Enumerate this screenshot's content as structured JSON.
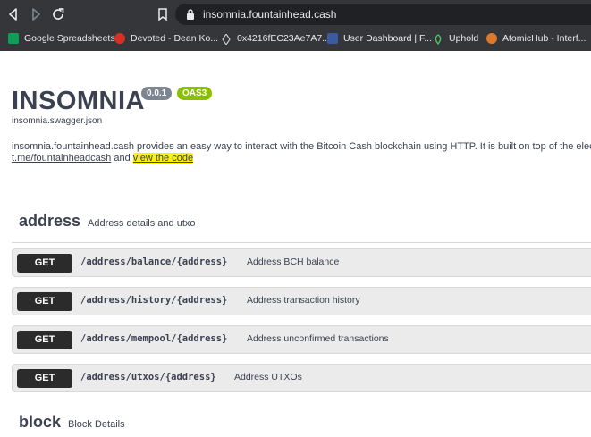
{
  "browser": {
    "url": "insomnia.fountainhead.cash",
    "bookmarks": [
      {
        "label": "Google Spreadsheets",
        "color": "#0f9d58"
      },
      {
        "label": "Devoted - Dean Ko...",
        "color": "#d93025"
      },
      {
        "label": "0x4216fEC23Ae7A7...",
        "color": "#9aa0a6"
      },
      {
        "label": "User Dashboard | F...",
        "color": "#3a5ba0"
      },
      {
        "label": "Uphold",
        "color": "#49cc68"
      },
      {
        "label": "AtomicHub - Interf...",
        "color": "#e0782a"
      }
    ]
  },
  "header": {
    "title": "INSOMNIA",
    "version": "0.0.1",
    "oas": "OAS3",
    "spec_file": "insomnia.swagger.json",
    "description": "insomnia.fountainhead.cash provides an easy way to interact with the Bitcoin Cash blockchain using HTTP. It is built on top of the electrum",
    "telegram_link": "t.me/fountainheadcash",
    "and_text": "and",
    "code_link": "view the code"
  },
  "tags": [
    {
      "name": "address",
      "description": "Address details and utxo",
      "operations": [
        {
          "method": "GET",
          "path": "/address/balance/{address}",
          "summary": "Address BCH balance"
        },
        {
          "method": "GET",
          "path": "/address/history/{address}",
          "summary": "Address transaction history"
        },
        {
          "method": "GET",
          "path": "/address/mempool/{address}",
          "summary": "Address unconfirmed transactions"
        },
        {
          "method": "GET",
          "path": "/address/utxos/{address}",
          "summary": "Address UTXOs"
        }
      ]
    },
    {
      "name": "block",
      "description": "Block Details"
    }
  ]
}
